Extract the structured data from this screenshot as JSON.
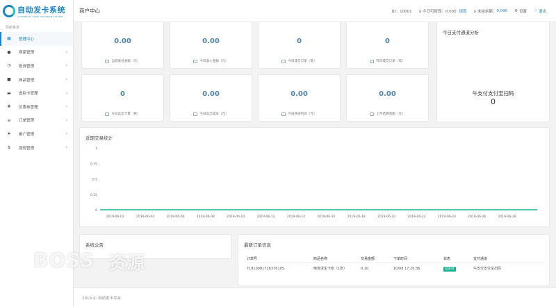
{
  "logo": {
    "title": "自动发卡系统",
    "subtitle": "AUTOMATIC CARD ISSUANCE SYSTEM"
  },
  "sidebar": {
    "heading": "导航菜单",
    "items": [
      {
        "label": "管理中心",
        "icon": "dashboard-icon",
        "glyph": "▦",
        "active": true,
        "arrow": ""
      },
      {
        "label": "商家管理",
        "icon": "user-icon",
        "glyph": "●",
        "arrow": "›"
      },
      {
        "label": "投诉管理",
        "icon": "clock-icon",
        "glyph": "◷",
        "arrow": "›"
      },
      {
        "label": "商品管理",
        "icon": "cube-icon",
        "glyph": "■",
        "arrow": "›"
      },
      {
        "label": "虚拟卡管理",
        "icon": "card-icon",
        "glyph": "▬",
        "arrow": "›"
      },
      {
        "label": "优惠券管理",
        "icon": "ticket-icon",
        "glyph": "❖",
        "arrow": "›"
      },
      {
        "label": "订单管理",
        "icon": "list-icon",
        "glyph": "≡",
        "arrow": "›"
      },
      {
        "label": "推广管理",
        "icon": "send-icon",
        "glyph": "➤",
        "arrow": "›"
      },
      {
        "label": "提现管理",
        "icon": "dollar-icon",
        "glyph": "$",
        "arrow": "›"
      }
    ]
  },
  "header": {
    "title": "商户中心",
    "id_label": "ID：10001",
    "withdraw_label": "$ 今日可提现：0.000",
    "withdraw_link": "提现",
    "unsettled_label": "$ 未结余额：",
    "unsettled_value": "0.090",
    "settings": "设置",
    "logout": "退出"
  },
  "stats": [
    {
      "value": "0.00",
      "label": "当前账号金额（元）",
      "icon": "wallet-icon"
    },
    {
      "value": "0.00",
      "label": "今日收入金额（元）",
      "icon": "coin-icon"
    },
    {
      "value": "0",
      "label": "今日成交订单（笔）",
      "icon": "order-icon"
    },
    {
      "value": "0",
      "label": "昨日成交订单（笔）",
      "icon": "calendar-icon"
    },
    {
      "value": "0",
      "label": "今日卖出卡量（张）",
      "icon": "card-icon"
    },
    {
      "value": "0.00",
      "label": "今日卖出成本（元）",
      "icon": "database-icon"
    },
    {
      "value": "0.00",
      "label": "今日获得利润（元）",
      "icon": "profit-icon"
    },
    {
      "value": "0.00",
      "label": "上月结算金额（元）",
      "icon": "settle-icon"
    }
  ],
  "channel": {
    "title": "今日支付通道分析",
    "name": "牛支付支付宝扫码",
    "value": "0"
  },
  "stats_panel": {
    "title": "近期交易统计"
  },
  "chart_data": {
    "type": "line",
    "title": "近期交易统计",
    "xlabel": "",
    "ylabel": "",
    "ylim": [
      0,
      1
    ],
    "yticks": [
      "0",
      "0.25",
      "0.5",
      "0.75",
      "1"
    ],
    "x": [
      "2019-06-01",
      "2019-06-02",
      "2019-06-03",
      "2019-06-04",
      "2019-06-05",
      "2019-06-06",
      "2019-06-07",
      "2019-06-08",
      "2019-06-09",
      "2019-06-10",
      "2019-06-11",
      "2019-06-12",
      "2019-06-13",
      "2019-06-14",
      "2019-06-15",
      "2019-06-16",
      "2019-06-17",
      "2019-06-18",
      "2019-06-19",
      "2019-06-20",
      "2019-06-21",
      "2019-06-22",
      "2019-06-23",
      "2019-06-24",
      "2019-06-25",
      "2019-06-26",
      "2019-06-27",
      "2019-06-28",
      "2019-06-29",
      "2019-06-30"
    ],
    "xticks": [
      "2019-06-02",
      "2019-06-04",
      "2019-06-06",
      "2019-06-08",
      "2019-06-10",
      "2019-06-12",
      "2019-06-14",
      "2019-06-16",
      "2019-06-18",
      "2019-06-20",
      "2019-06-22",
      "2019-06-24",
      "2019-06-26",
      "2019-06-28"
    ],
    "series": [
      {
        "values": [
          0,
          0,
          0,
          0,
          0,
          0,
          0,
          0,
          0,
          0,
          0,
          0,
          0,
          0,
          0,
          0,
          0,
          0,
          0,
          0,
          0,
          0,
          0,
          0,
          0,
          0,
          0,
          0,
          0,
          0
        ],
        "color": "#1ab394"
      }
    ],
    "grid": false
  },
  "notice": {
    "title": "系统公告"
  },
  "orders": {
    "title": "最新订单信息",
    "columns": [
      "订单号",
      "商品名称",
      "交易金额",
      "下单时间",
      "状态",
      "支付通道"
    ],
    "rows": [
      {
        "id": "T181008172637610S",
        "product": "绝地求生卡密（1张）",
        "amount": "0.10",
        "time": "10/08 17:26:36",
        "status": "已支付",
        "channel": "牛支付支付宝扫码"
      }
    ]
  },
  "footer": {
    "text": "2019 © 自动发卡平台"
  },
  "watermark": {
    "latin": "BOSS",
    "cn": "资源"
  },
  "colors": {
    "accent": "#1c84c6",
    "stat_value": "#5084ad",
    "success": "#1ab394"
  }
}
